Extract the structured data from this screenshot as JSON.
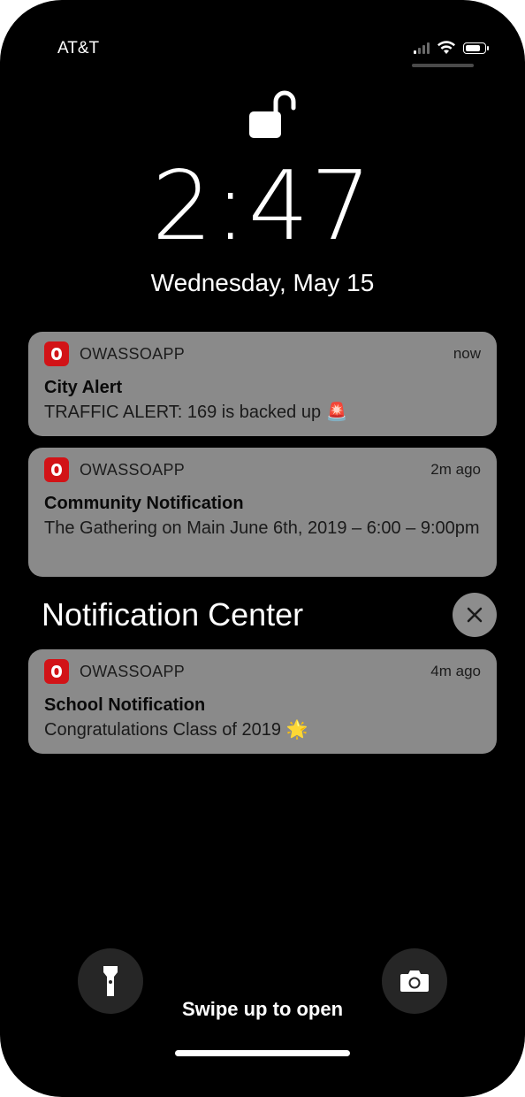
{
  "status_bar": {
    "carrier": "AT&T",
    "signal_bars": 4,
    "signal_active": 1,
    "battery_level": 0.85
  },
  "lock": {
    "icon": "unlocked-padlock-icon"
  },
  "clock": {
    "time": "2:47",
    "date": "Wednesday, May 15"
  },
  "notifications": [
    {
      "app": "OWASSOAPP",
      "time": "now",
      "title": "City Alert",
      "body": "TRAFFIC ALERT: 169 is backed up 🚨"
    },
    {
      "app": "OWASSOAPP",
      "time": "2m ago",
      "title": "Community Notification",
      "body": "The Gathering on Main June 6th, 2019 – 6:00 – 9:00pm"
    }
  ],
  "notification_center": {
    "title": "Notification Center",
    "close_icon": "close-icon",
    "items": [
      {
        "app": "OWASSOAPP",
        "time": "4m ago",
        "title": "School Notification",
        "body": "Congratulations Class of 2019 🌟"
      }
    ]
  },
  "bottom": {
    "flashlight_icon": "flashlight-icon",
    "camera_icon": "camera-icon",
    "swipe_text": "Swipe up to open"
  },
  "colors": {
    "card_background": "#8a8a8a",
    "app_icon": "#d21317",
    "background": "#000000"
  }
}
